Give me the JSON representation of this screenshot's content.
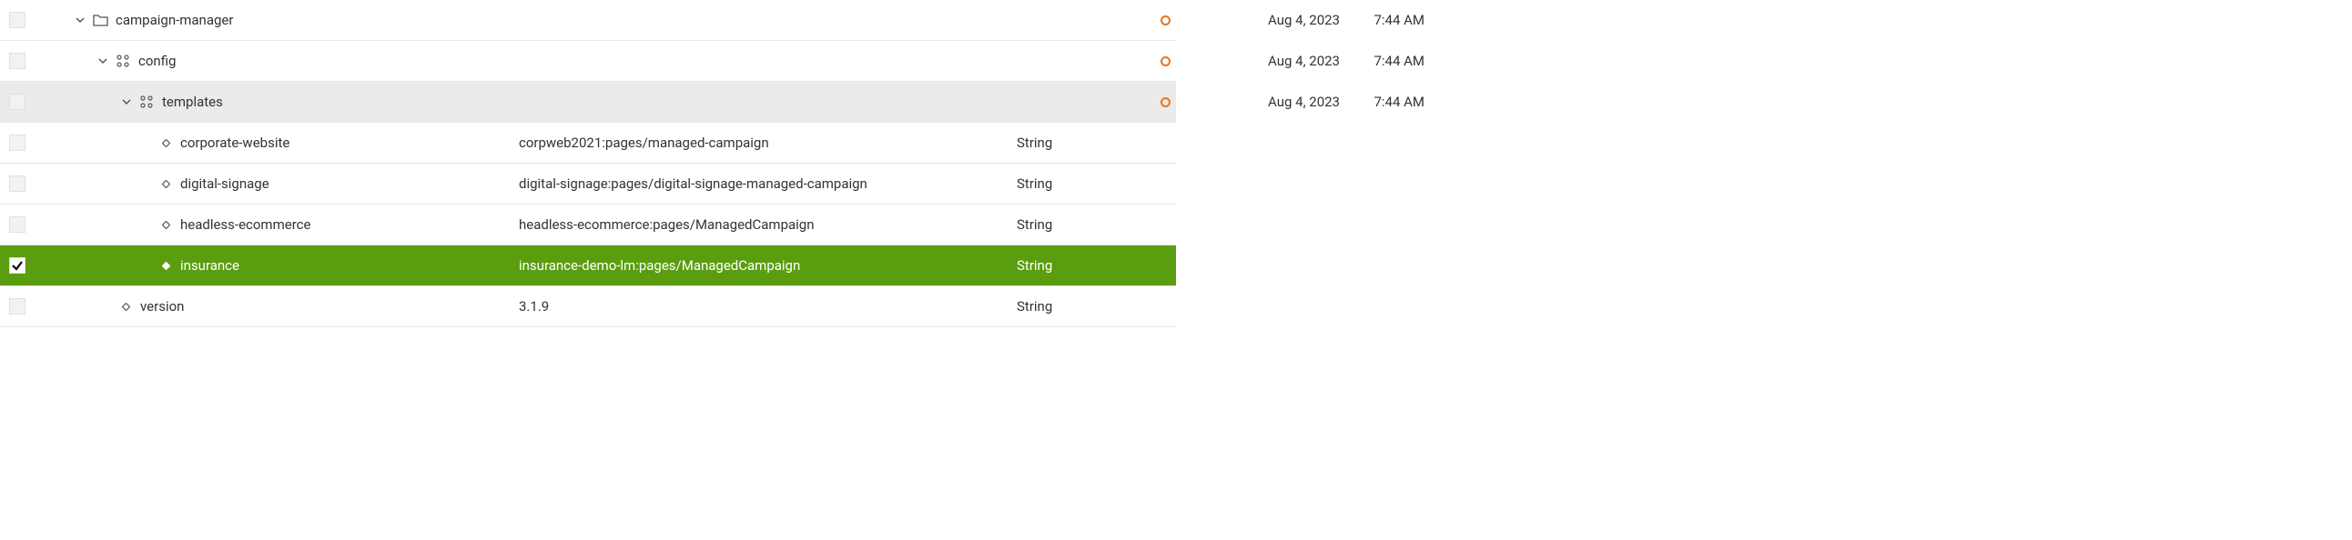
{
  "rows": [
    {
      "name": "campaign-manager",
      "indent": 45,
      "kind": "folder",
      "expanded": true,
      "selected": false,
      "highlighted": false,
      "value": "",
      "type": "",
      "status": "modified",
      "date": "Aug 4, 2023",
      "time": "7:44 AM"
    },
    {
      "name": "config",
      "indent": 70,
      "kind": "node",
      "expanded": true,
      "selected": false,
      "highlighted": false,
      "value": "",
      "type": "",
      "status": "modified",
      "date": "Aug 4, 2023",
      "time": "7:44 AM"
    },
    {
      "name": "templates",
      "indent": 96,
      "kind": "node",
      "expanded": true,
      "selected": false,
      "highlighted": true,
      "value": "",
      "type": "",
      "status": "modified",
      "date": "Aug 4, 2023",
      "time": "7:44 AM"
    },
    {
      "name": "corporate-website",
      "indent": 140,
      "kind": "property",
      "selected": false,
      "highlighted": false,
      "value": "corpweb2021:pages/managed-campaign",
      "type": "String",
      "status": "",
      "date": "",
      "time": ""
    },
    {
      "name": "digital-signage",
      "indent": 140,
      "kind": "property",
      "selected": false,
      "highlighted": false,
      "value": "digital-signage:pages/digital-signage-managed-campaign",
      "type": "String",
      "status": "",
      "date": "",
      "time": ""
    },
    {
      "name": "headless-ecommerce",
      "indent": 140,
      "kind": "property",
      "selected": false,
      "highlighted": false,
      "value": "headless-ecommerce:pages/ManagedCampaign",
      "type": "String",
      "status": "",
      "date": "",
      "time": ""
    },
    {
      "name": "insurance",
      "indent": 140,
      "kind": "property",
      "selected": true,
      "highlighted": false,
      "value": "insurance-demo-lm:pages/ManagedCampaign",
      "type": "String",
      "status": "",
      "date": "",
      "time": ""
    },
    {
      "name": "version",
      "indent": 96,
      "kind": "property",
      "selected": false,
      "highlighted": false,
      "value": "3.1.9",
      "type": "String",
      "status": "",
      "date": "",
      "time": ""
    }
  ]
}
